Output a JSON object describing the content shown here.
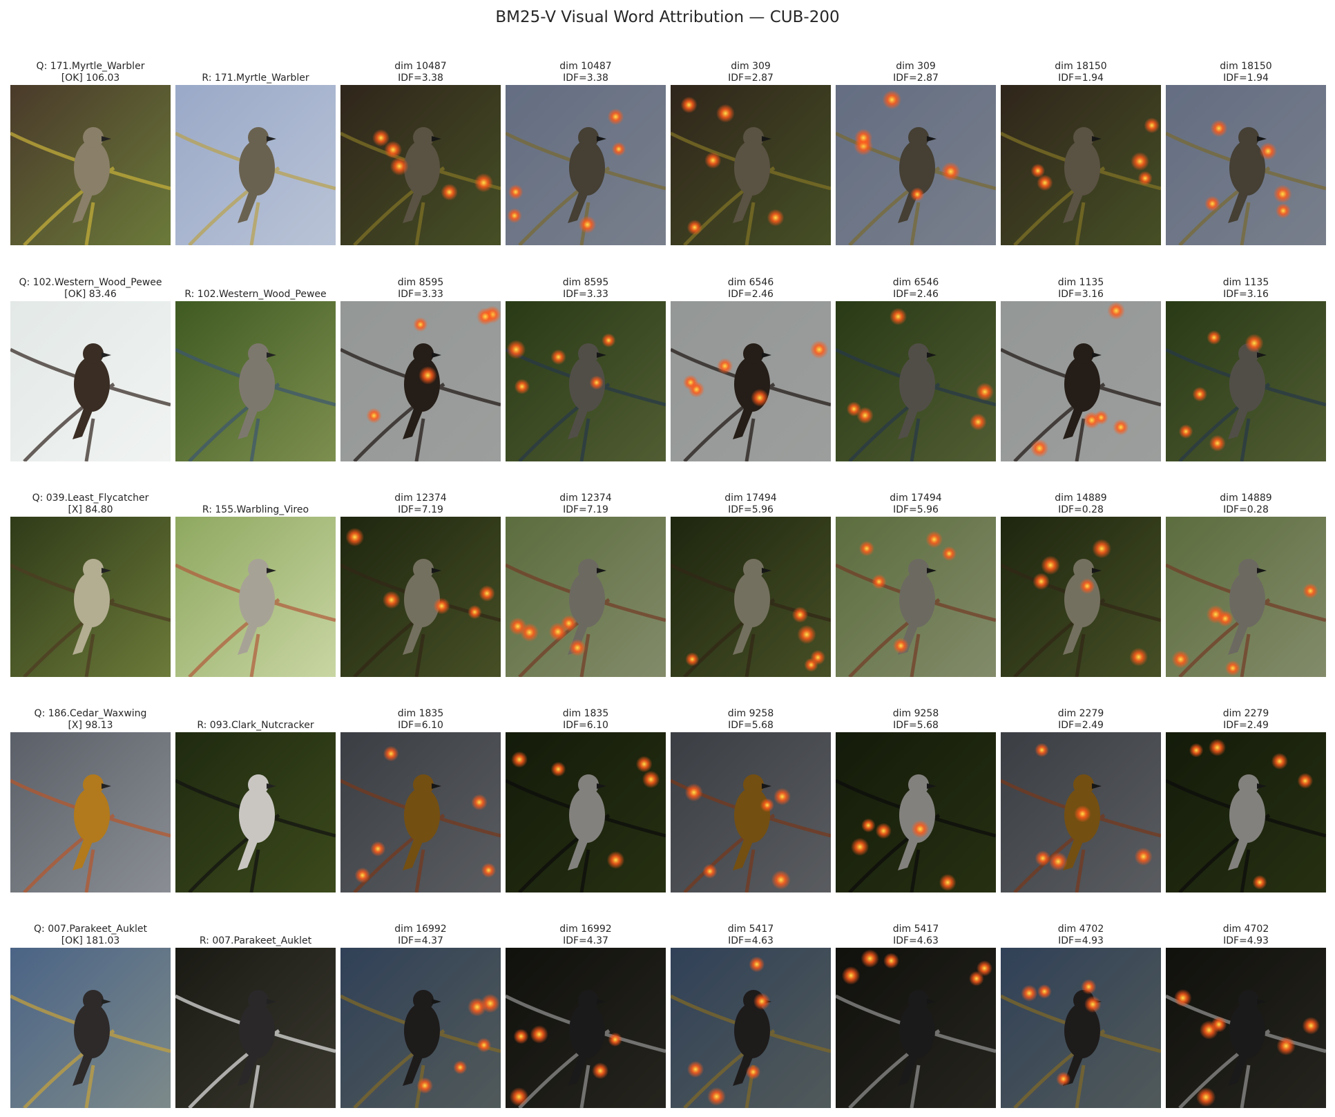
{
  "title": "BM25-V Visual Word Attribution — CUB-200",
  "rows": [
    {
      "query_label": "Q: 171.Myrtle_Warbler",
      "query_score": "[OK] 106.03",
      "retrieved_label": "R: 171.Myrtle_Warbler",
      "dims": [
        {
          "dim": "dim 10487",
          "idf": "IDF=3.38"
        },
        {
          "dim": "dim 309",
          "idf": "IDF=2.87"
        },
        {
          "dim": "dim 18150",
          "idf": "IDF=1.94"
        }
      ]
    },
    {
      "query_label": "Q: 102.Western_Wood_Pewee",
      "query_score": "[OK] 83.46",
      "retrieved_label": "R: 102.Western_Wood_Pewee",
      "dims": [
        {
          "dim": "dim 8595",
          "idf": "IDF=3.33"
        },
        {
          "dim": "dim 6546",
          "idf": "IDF=2.46"
        },
        {
          "dim": "dim 1135",
          "idf": "IDF=3.16"
        }
      ]
    },
    {
      "query_label": "Q: 039.Least_Flycatcher",
      "query_score": "[X] 84.80",
      "retrieved_label": "R: 155.Warbling_Vireo",
      "dims": [
        {
          "dim": "dim 12374",
          "idf": "IDF=7.19"
        },
        {
          "dim": "dim 17494",
          "idf": "IDF=5.96"
        },
        {
          "dim": "dim 14889",
          "idf": "IDF=0.28"
        }
      ]
    },
    {
      "query_label": "Q: 186.Cedar_Waxwing",
      "query_score": "[X] 98.13",
      "retrieved_label": "R: 093.Clark_Nutcracker",
      "dims": [
        {
          "dim": "dim 1835",
          "idf": "IDF=6.10"
        },
        {
          "dim": "dim 9258",
          "idf": "IDF=5.68"
        },
        {
          "dim": "dim 2279",
          "idf": "IDF=2.49"
        }
      ]
    },
    {
      "query_label": "Q: 007.Parakeet_Auklet",
      "query_score": "[OK] 181.03",
      "retrieved_label": "R: 007.Parakeet_Auklet",
      "dims": [
        {
          "dim": "dim 16992",
          "idf": "IDF=4.37"
        },
        {
          "dim": "dim 5417",
          "idf": "IDF=4.63"
        },
        {
          "dim": "dim 4702",
          "idf": "IDF=4.93"
        }
      ]
    }
  ],
  "scenes": [
    {
      "query": {
        "bg1": "#4a3a2a",
        "bg2": "#6b7a3a",
        "bird": "#8a7f68",
        "accent": "#c9b23a"
      },
      "ret": {
        "bg1": "#9aa9c8",
        "bg2": "#b9c3d6",
        "bird": "#6a6250",
        "accent": "#b9a14a"
      }
    },
    {
      "query": {
        "bg1": "#e3e9e7",
        "bg2": "#f0f3f1",
        "bird": "#3a2d24",
        "accent": "#2d211b"
      },
      "ret": {
        "bg1": "#3f5a22",
        "bg2": "#7d8f4f",
        "bird": "#7d786e",
        "accent": "#3c5670"
      }
    },
    {
      "query": {
        "bg1": "#2f3b18",
        "bg2": "#6c7a3a",
        "bird": "#b3ad92",
        "accent": "#4d3a22"
      },
      "ret": {
        "bg1": "#8ea860",
        "bg2": "#c9d6a3",
        "bird": "#a7a296",
        "accent": "#b05a3a"
      }
    },
    {
      "query": {
        "bg1": "#5b6068",
        "bg2": "#8a8e94",
        "bird": "#b27a1c",
        "accent": "#b8562a"
      },
      "ret": {
        "bg1": "#1f2a10",
        "bg2": "#3c4a1c",
        "bird": "#c9c6c2",
        "accent": "#111111"
      }
    },
    {
      "query": {
        "bg1": "#4b6486",
        "bg2": "#7d8a8a",
        "bird": "#2e2a2a",
        "accent": "#c8a23a"
      },
      "ret": {
        "bg1": "#1a1a14",
        "bg2": "#3a382e",
        "bird": "#2a2828",
        "accent": "#e6e6e6"
      }
    }
  ],
  "colors": {
    "hotspot_core": "#ffe14a",
    "hotspot_mid": "#ff5a1a",
    "overlay_dim": "#000000"
  }
}
